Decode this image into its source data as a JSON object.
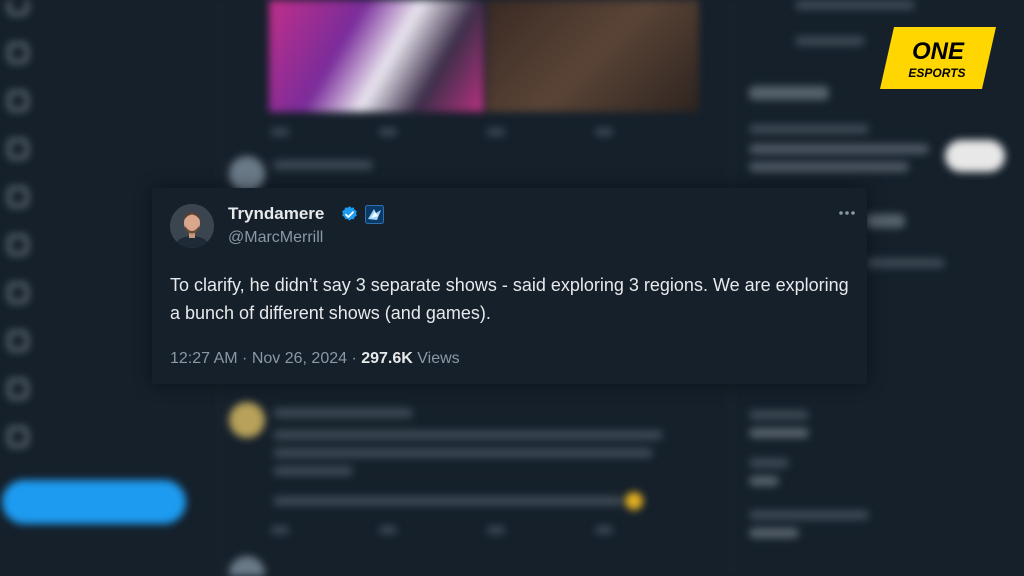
{
  "tweet": {
    "display_name": "Tryndamere",
    "handle": "@MarcMerrill",
    "text": "To clarify, he didn’t say 3 separate shows - said exploring 3 regions. We are exploring a bunch of different shows (and games).",
    "time": "12:27 AM",
    "separator": " · ",
    "date": "Nov 26, 2024",
    "views_count": "297.6K",
    "views_label": " Views"
  },
  "logo": {
    "line1": "ONE",
    "line2": "ESPORTS",
    "color": "#ffd600"
  },
  "icons": {
    "verified": "verified-badge-icon",
    "affiliate": "affiliate-badge-icon",
    "more": "more-options-icon"
  },
  "colors": {
    "background": "#15202b",
    "accent": "#1d9bf0",
    "text_primary": "#e7e9ea",
    "text_secondary": "#8b98a5"
  }
}
